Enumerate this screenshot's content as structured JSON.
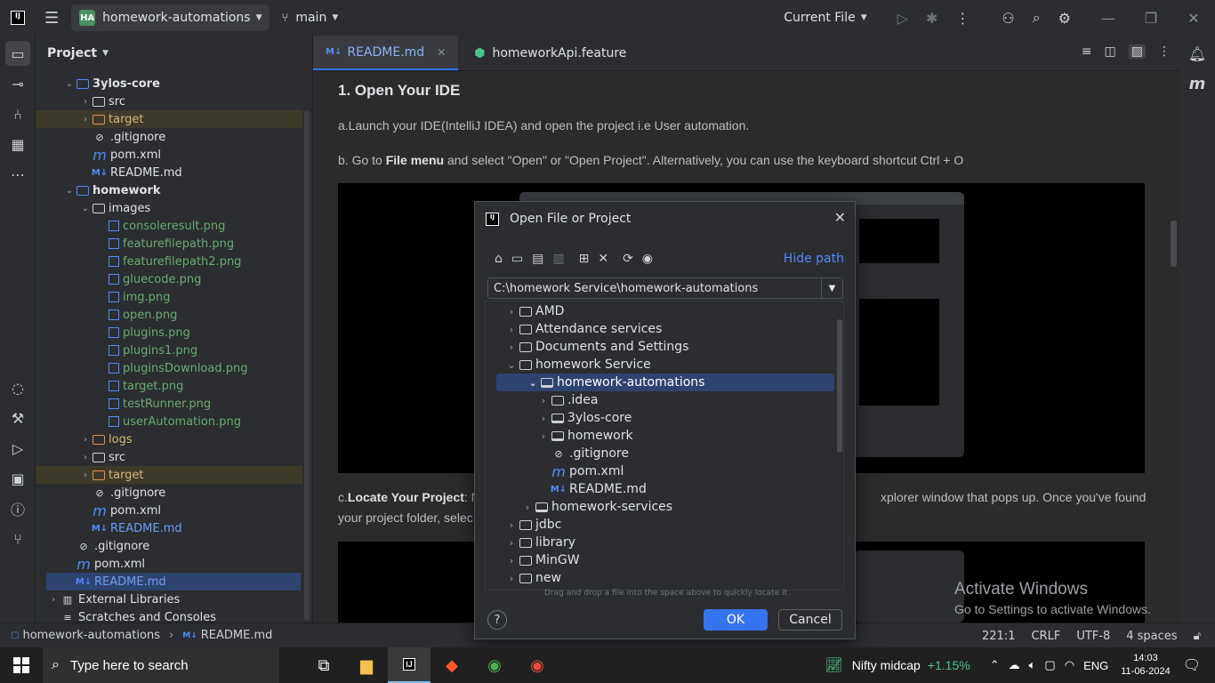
{
  "titlebar": {
    "project_badge": "HA",
    "project_name": "homework-automations",
    "branch": "main",
    "run_config": "Current File"
  },
  "project_panel": {
    "title": "Project",
    "tree": [
      {
        "label": "3ylos-core",
        "depth": 1,
        "kind": "module",
        "expanded": true
      },
      {
        "label": "src",
        "depth": 2,
        "kind": "folder"
      },
      {
        "label": "target",
        "depth": 2,
        "kind": "folder-orange",
        "highlight": "target"
      },
      {
        "label": ".gitignore",
        "depth": 2,
        "kind": "ignore"
      },
      {
        "label": "pom.xml",
        "depth": 2,
        "kind": "maven"
      },
      {
        "label": "README.md",
        "depth": 2,
        "kind": "md"
      },
      {
        "label": "homework",
        "depth": 1,
        "kind": "module",
        "expanded": true
      },
      {
        "label": "images",
        "depth": 2,
        "kind": "folder",
        "expanded": true
      },
      {
        "label": "consoleresult.png",
        "depth": 3,
        "kind": "image"
      },
      {
        "label": "featurefilepath.png",
        "depth": 3,
        "kind": "image"
      },
      {
        "label": "featurefilepath2.png",
        "depth": 3,
        "kind": "image"
      },
      {
        "label": "gluecode.png",
        "depth": 3,
        "kind": "image"
      },
      {
        "label": "img.png",
        "depth": 3,
        "kind": "image"
      },
      {
        "label": "open.png",
        "depth": 3,
        "kind": "image"
      },
      {
        "label": "plugins.png",
        "depth": 3,
        "kind": "image"
      },
      {
        "label": "plugins1.png",
        "depth": 3,
        "kind": "image"
      },
      {
        "label": "pluginsDownload.png",
        "depth": 3,
        "kind": "image"
      },
      {
        "label": "target.png",
        "depth": 3,
        "kind": "image"
      },
      {
        "label": "testRunner.png",
        "depth": 3,
        "kind": "image"
      },
      {
        "label": "userAutomation.png",
        "depth": 3,
        "kind": "image"
      },
      {
        "label": "logs",
        "depth": 2,
        "kind": "folder-orange-text"
      },
      {
        "label": "src",
        "depth": 2,
        "kind": "folder"
      },
      {
        "label": "target",
        "depth": 2,
        "kind": "folder-orange",
        "highlight": "target"
      },
      {
        "label": ".gitignore",
        "depth": 2,
        "kind": "ignore"
      },
      {
        "label": "pom.xml",
        "depth": 2,
        "kind": "maven"
      },
      {
        "label": "README.md",
        "depth": 2,
        "kind": "md-blue"
      },
      {
        "label": ".gitignore",
        "depth": 1,
        "kind": "ignore"
      },
      {
        "label": "pom.xml",
        "depth": 1,
        "kind": "maven"
      },
      {
        "label": "README.md",
        "depth": 1,
        "kind": "md-blue",
        "highlight": "sel"
      },
      {
        "label": "External Libraries",
        "depth": 0,
        "kind": "libs"
      },
      {
        "label": "Scratches and Consoles",
        "depth": 0,
        "kind": "scratch"
      }
    ]
  },
  "editor": {
    "tabs": [
      {
        "label": "README.md",
        "icon": "markdown-icon",
        "active": true
      },
      {
        "label": "homeworkApi.feature",
        "icon": "cucumber-icon",
        "active": false
      }
    ],
    "heading": "1. Open Your IDE",
    "para_a": "a.Launch your IDE(IntelliJ IDEA) and open the project i.e User automation.",
    "para_b_pre": "b. Go to ",
    "para_b_bold": "File menu",
    "para_b_post": " and select \"Open\" or \"Open Project\". Alternatively, you can use the keyboard shortcut Ctrl + O",
    "para_c_pre": "c.",
    "para_c_bold": "Locate Your Project",
    "para_c_mid": ": N",
    "para_c_right": "xplorer window that pops up. Once you've found",
    "para_c_line2": "your project folder, selec"
  },
  "dialog": {
    "title": "Open File or Project",
    "hide_path": "Hide path",
    "path": "C:\\homework Service\\homework-automations",
    "tree": [
      {
        "label": "AMD",
        "depth": 0,
        "arrow": "right"
      },
      {
        "label": "Attendance services",
        "depth": 0,
        "arrow": "right"
      },
      {
        "label": "Documents and Settings",
        "depth": 0,
        "arrow": "right"
      },
      {
        "label": "homework Service",
        "depth": 0,
        "arrow": "down"
      },
      {
        "label": "homework-automations",
        "depth": 1,
        "arrow": "down",
        "kind": "project",
        "selected": true
      },
      {
        "label": ".idea",
        "depth": 2,
        "arrow": "right"
      },
      {
        "label": "3ylos-core",
        "depth": 2,
        "arrow": "right",
        "kind": "project"
      },
      {
        "label": "homework",
        "depth": 2,
        "arrow": "right",
        "kind": "project"
      },
      {
        "label": ".gitignore",
        "depth": 2,
        "arrow": "none",
        "kind": "ignore"
      },
      {
        "label": "pom.xml",
        "depth": 2,
        "arrow": "none",
        "kind": "maven"
      },
      {
        "label": "README.md",
        "depth": 2,
        "arrow": "none",
        "kind": "md"
      },
      {
        "label": "homework-services",
        "depth": 1,
        "arrow": "right",
        "kind": "project"
      },
      {
        "label": "jdbc",
        "depth": 0,
        "arrow": "right"
      },
      {
        "label": "library",
        "depth": 0,
        "arrow": "right"
      },
      {
        "label": "MinGW",
        "depth": 0,
        "arrow": "right"
      },
      {
        "label": "new",
        "depth": 0,
        "arrow": "right"
      }
    ],
    "hint": "Drag and drop a file into the space above to quickly locate it",
    "ok": "OK",
    "cancel": "Cancel",
    "help": "?"
  },
  "watermark": {
    "line1": "Activate Windows",
    "line2": "Go to Settings to activate Windows."
  },
  "statusbar": {
    "crumb_project": "homework-automations",
    "crumb_file": "README.md",
    "position": "221:1",
    "line_sep": "CRLF",
    "encoding": "UTF-8",
    "indent": "4 spaces"
  },
  "taskbar": {
    "search_placeholder": "Type here to search",
    "stock_name": "Nifty midcap",
    "stock_change": "+1.15%",
    "lang": "ENG",
    "time": "14:03",
    "date": "11-06-2024"
  },
  "colors": {
    "accent": "#3574f0",
    "selection": "#2e436e",
    "stock_up": "#4cc38a"
  }
}
